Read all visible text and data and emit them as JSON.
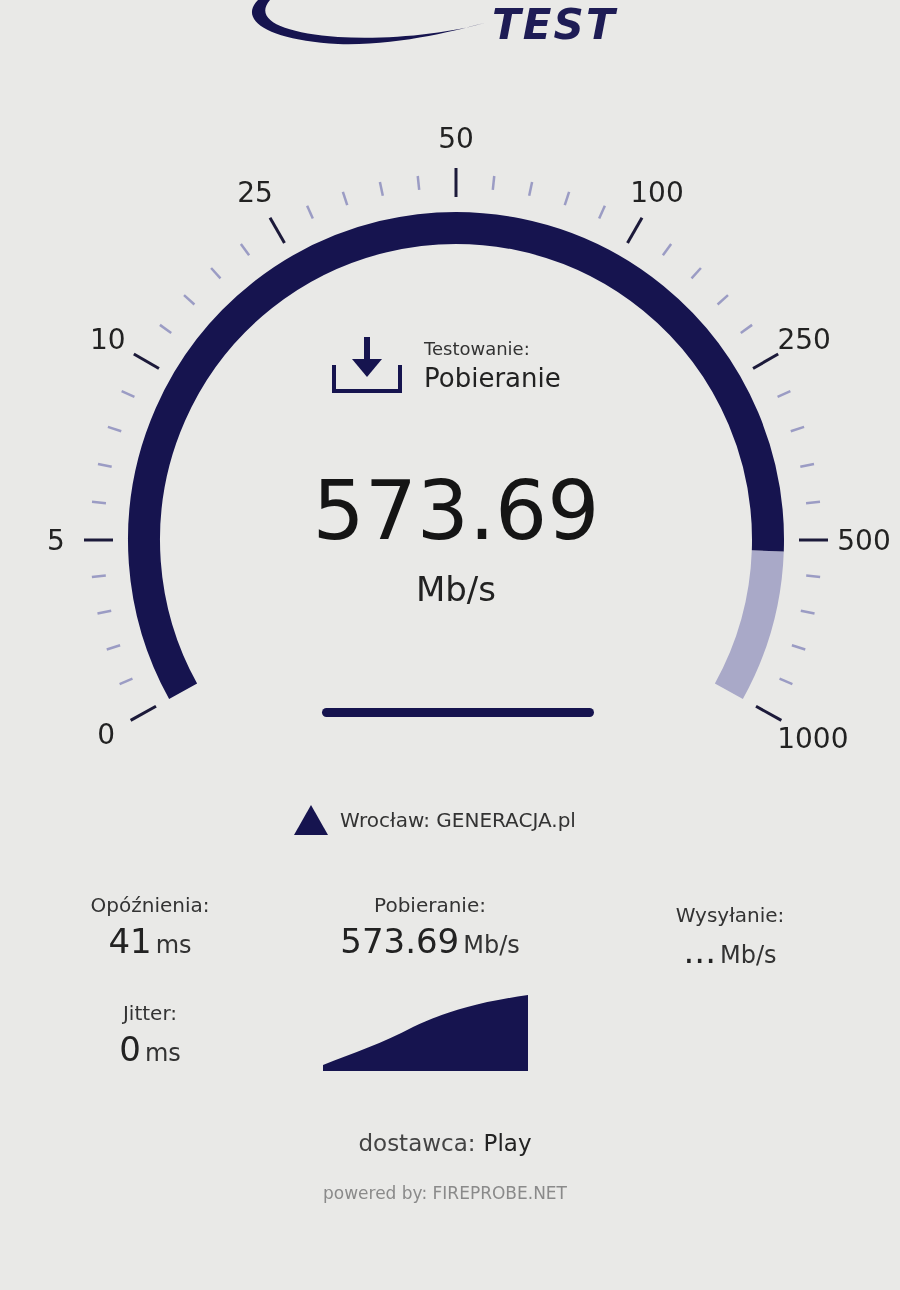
{
  "logo": {
    "text": "TEST"
  },
  "gauge": {
    "scale": [
      {
        "label": "0"
      },
      {
        "label": "5"
      },
      {
        "label": "10"
      },
      {
        "label": "25"
      },
      {
        "label": "50"
      },
      {
        "label": "100"
      },
      {
        "label": "250"
      },
      {
        "label": "500"
      },
      {
        "label": "1000"
      }
    ]
  },
  "status": {
    "label": "Testowanie:",
    "phase": "Pobieranie"
  },
  "reading": {
    "value": "573.69",
    "unit": "Mb/s"
  },
  "server": {
    "text": "Wrocław: GENERACJA.pl"
  },
  "stats": [
    {
      "label": "Opóźnienia:",
      "value": "41",
      "unit": "ms"
    },
    {
      "label": "Pobieranie:",
      "value": "573.69",
      "unit": "Mb/s"
    },
    {
      "label": "Wysyłanie:",
      "value": "...",
      "unit": "Mb/s"
    },
    {
      "label": "Jitter:",
      "value": "0",
      "unit": "ms"
    }
  ],
  "provider": {
    "label": "dostawca:",
    "value": "Play"
  },
  "footer": "powered by: FIREPROBE.NET"
}
